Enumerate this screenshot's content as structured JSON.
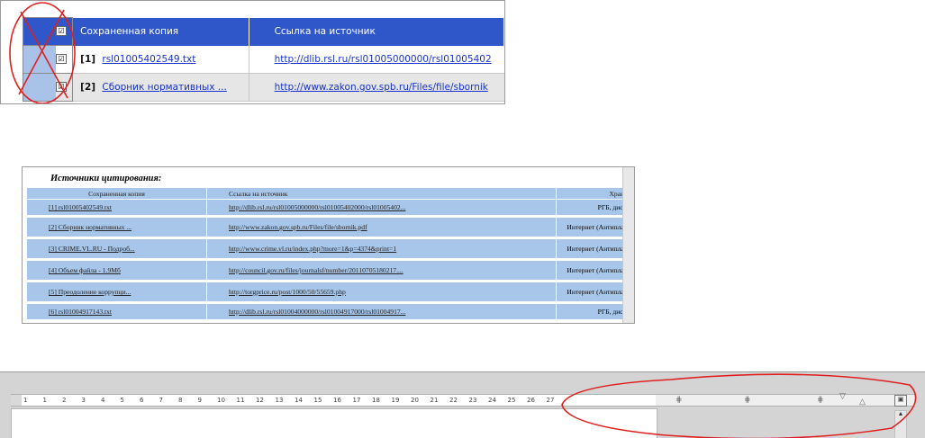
{
  "panel1": {
    "columns": [
      "Сохраненная копия",
      "Ссылка на источник"
    ],
    "rows": [
      {
        "num": "[1]",
        "copy": "rsl01005402549.txt",
        "link": "http://dlib.rsl.ru/rsl01005000000/rsl01005402"
      },
      {
        "num": "[2]",
        "copy": "Сборник нормативных ...",
        "link": "http://www.zakon.gov.spb.ru/Files/file/sbornik"
      }
    ],
    "checkbox_glyph": "☑"
  },
  "panel2": {
    "caption": "Источники цитирования:",
    "columns": [
      "Сохраненная копия",
      "Ссылка на источник",
      "Хранили"
    ],
    "rows": [
      {
        "copy": "[1] rsl01005402549.txt",
        "link": "http://dlib.rsl.ru/rsl01005000000/rsl01005402000/rsl01005402...",
        "storage": "РГБ, диссерта"
      },
      {
        "copy": "[2] Сборник нормативных ...",
        "link": "http://www.zakon.gov.spb.ru/Files/file/sbornik.pdf",
        "storage": "Интернет (Антиплагиат)"
      },
      {
        "copy": "[3] CRIME.VL.RU - Подроб...",
        "link": "http://www.crime.vl.ru/index.php?more=1&p=4374&print=1",
        "storage": "Интернет (Антиплагиат)"
      },
      {
        "copy": "[4] Объем файла - 1.9Мб",
        "link": "http://council.gov.ru/files/journalsf/number/20110705180217....",
        "storage": "Интернет (Антиплагиат)"
      },
      {
        "copy": "[5] Преодоление коррупци...",
        "link": "http://torgprice.ru/post/1000/50/55659.php",
        "storage": "Интернет (Антиплагиат)"
      },
      {
        "copy": "[6] rsl01004917143.txt",
        "link": "http://dlib.rsl.ru/rsl01004000000/rsl01004917000/rsl01004917...",
        "storage": "РГБ, диссерта"
      }
    ]
  },
  "panel3": {
    "ruler_numbers": [
      "1",
      "1",
      "2",
      "3",
      "4",
      "5",
      "6",
      "7",
      "8",
      "9",
      "10",
      "11",
      "12",
      "13",
      "14",
      "15",
      "16",
      "17",
      "18",
      "19",
      "20",
      "21",
      "22",
      "23",
      "24",
      "25",
      "26",
      "27"
    ],
    "ruler_button_glyph": "▣",
    "scroll_glyph": "▲"
  },
  "colors": {
    "annotation_red": "#e02020",
    "header_blue": "#2f57c9",
    "row_blue": "#a8c6ea"
  }
}
